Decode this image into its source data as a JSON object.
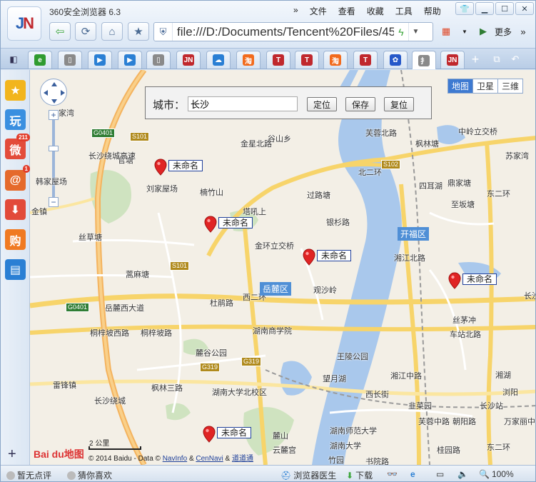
{
  "app": {
    "title": "360安全浏览器 6.3",
    "logo_text": "JN"
  },
  "menu": [
    {
      "label": "»"
    },
    {
      "label": "文件"
    },
    {
      "label": "查看"
    },
    {
      "label": "收藏"
    },
    {
      "label": "工具"
    },
    {
      "label": "帮助"
    }
  ],
  "address": {
    "url": "file:///D:/Documents/Tencent%20Files/458"
  },
  "toolbar": {
    "more_label": "更多"
  },
  "tabs": [
    {
      "icon": "360-icon",
      "color": "#2f9b2f",
      "glyph": "e"
    },
    {
      "icon": "page-icon",
      "color": "#8a8a8a",
      "glyph": "▯"
    },
    {
      "icon": "play-icon",
      "color": "#2a7fd4",
      "glyph": "▶"
    },
    {
      "icon": "play-icon",
      "color": "#2a7fd4",
      "glyph": "▶"
    },
    {
      "icon": "page-icon",
      "color": "#8a8a8a",
      "glyph": "▯"
    },
    {
      "icon": "jn-icon",
      "color": "#c0282d",
      "glyph": "JN"
    },
    {
      "icon": "cloud-icon",
      "color": "#2a7fd4",
      "glyph": "☁"
    },
    {
      "icon": "taobao-icon",
      "color": "#f26b1d",
      "glyph": "淘"
    },
    {
      "icon": "t-icon",
      "color": "#c0282d",
      "glyph": "T"
    },
    {
      "icon": "t-icon",
      "color": "#c0282d",
      "glyph": "T"
    },
    {
      "icon": "taobao-icon",
      "color": "#f26b1d",
      "glyph": "淘"
    },
    {
      "icon": "t-icon",
      "color": "#c0282d",
      "glyph": "T"
    },
    {
      "icon": "baidu-paw-icon",
      "color": "#2558c9",
      "glyph": "✿"
    },
    {
      "icon": "page-icon",
      "color": "#8a8a8a",
      "glyph": "扌"
    },
    {
      "icon": "jn-icon",
      "color": "#c0282d",
      "glyph": "JN"
    }
  ],
  "sidebar": [
    {
      "icon": "star-icon",
      "color": "#f2b51d",
      "glyph": "★"
    },
    {
      "icon": "play-game-icon",
      "color": "#3a8fe0",
      "glyph": "玩"
    },
    {
      "icon": "weibo-icon",
      "color": "#e34b3b",
      "glyph": "微",
      "badge": "211"
    },
    {
      "icon": "mail-icon",
      "color": "#e56a2c",
      "glyph": "@",
      "badge": "1"
    },
    {
      "icon": "download-icon",
      "color": "#e24a3a",
      "glyph": "⬇"
    },
    {
      "icon": "shopping-icon",
      "color": "#f07a22",
      "glyph": "购"
    },
    {
      "icon": "book-icon",
      "color": "#2a7fd4",
      "glyph": "▤"
    }
  ],
  "map": {
    "types": [
      {
        "label": "地图",
        "active": true
      },
      {
        "label": "卫星"
      },
      {
        "label": "三维"
      }
    ],
    "city_label": "城市：",
    "city_value": "长沙",
    "buttons": {
      "locate": "定位",
      "save": "保存",
      "reset": "复位"
    },
    "markers": [
      {
        "label": "未命名"
      },
      {
        "label": "未命名"
      },
      {
        "label": "未命名"
      },
      {
        "label": "未命名"
      },
      {
        "label": "未命名"
      }
    ],
    "places": [
      "家湾",
      "谷山乡",
      "官塘",
      "刘家屋场",
      "楠竹山",
      "韩家屋场",
      "金镇",
      "塔吼上",
      "过路塘",
      "丝草塘",
      "金环立交桥",
      "观沙岭",
      "蒿麻塘",
      "杜鹃路",
      "湖南商学院",
      "麓谷公园",
      "王陵公园",
      "望月湖",
      "湖南大学北校区",
      "雷锋镇",
      "湖南师范大学",
      "湖南大学",
      "竹园",
      "书院路",
      "麓山",
      "云麓宫",
      "西长街",
      "韭菜园",
      "芙蓉中路",
      "朝阳路",
      "长沙站",
      "丝茅冲",
      "车站北路",
      "四耳湖",
      "枫林塘",
      "中岭立交桥",
      "苏家湾",
      "桂园路",
      "湘湖",
      "浏阳",
      "万家丽中路",
      "鼎家塘",
      "至坂塘",
      "长沙",
      "桐梓坡西路",
      "桐梓坡路",
      "岳麓西大道",
      "枫林三路",
      "长沙绕城高速",
      "湘江北路",
      "长沙绕城",
      "金星北路",
      "芙蓉北路",
      "北二环",
      "东二环",
      "银杉路",
      "西二环",
      "湘江中路",
      "东二环"
    ],
    "districts": [
      "开福区",
      "岳麓区"
    ],
    "road_badges": [
      "G0401",
      "S101",
      "S102",
      "S101",
      "G0401",
      "G319",
      "G319"
    ],
    "scale_label": "2 公里",
    "copyright_prefix": "© 2014 Baidu - Data ©",
    "copyright_links": [
      "NavInfo",
      "CenNavi",
      "道道通"
    ],
    "copyright_sep": "&",
    "baidu_logo": "Bai du地图"
  },
  "status": {
    "rating": "暂无点评",
    "guess": "猜你喜欢",
    "doctor": "浏览器医生",
    "download": "下载",
    "zoom": "100%"
  }
}
